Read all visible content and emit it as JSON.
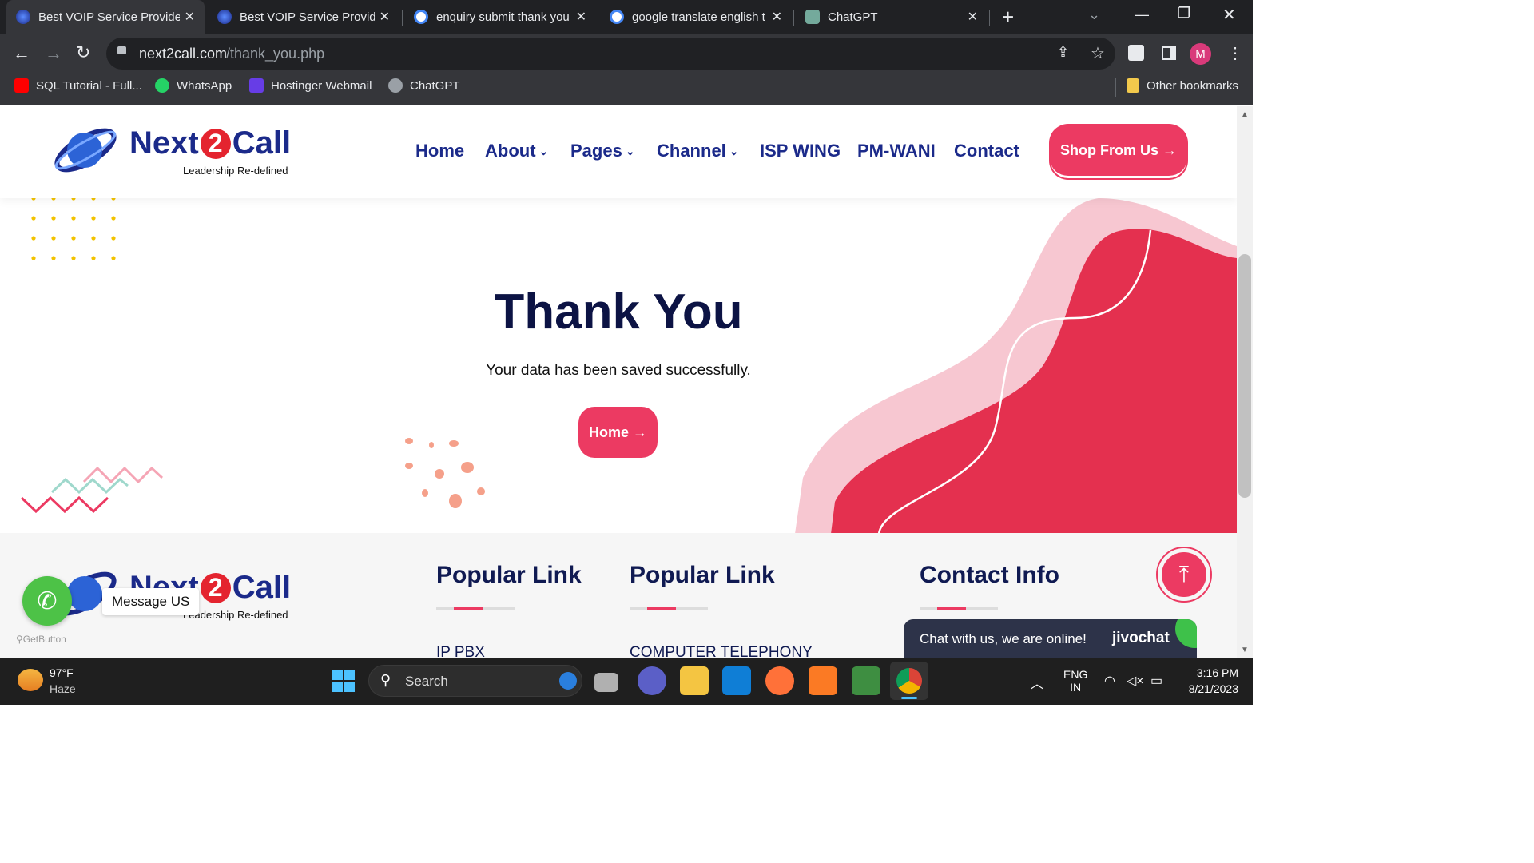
{
  "browser": {
    "tabs": [
      {
        "title": "Best VOIP Service Provider",
        "active": true
      },
      {
        "title": "Best VOIP Service Provider",
        "active": false
      },
      {
        "title": "enquiry submit thank you",
        "active": false
      },
      {
        "title": "google translate english t",
        "active": false
      },
      {
        "title": "ChatGPT",
        "active": false
      }
    ],
    "url_domain": "next2call.com",
    "url_path": "/thank_you.php",
    "profile_initial": "M",
    "bookmarks": [
      {
        "label": "SQL Tutorial - Full...",
        "color": "#ff0000"
      },
      {
        "label": "WhatsApp",
        "color": "#25d366"
      },
      {
        "label": "Hostinger Webmail",
        "color": "#673de6"
      },
      {
        "label": "ChatGPT",
        "color": "#9aa0a6"
      }
    ],
    "other_bookmarks": "Other bookmarks"
  },
  "site": {
    "logo_next": "Next",
    "logo_two": "2",
    "logo_call": "Call",
    "tagline": "Leadership Re-defined",
    "nav": [
      "Home",
      "About",
      "Pages",
      "Channel",
      "ISP WING",
      "PM-WANI",
      "Contact"
    ],
    "nav_dropdown": [
      false,
      true,
      true,
      true,
      false,
      false,
      false
    ],
    "shop_button": "Shop From Us →",
    "heading": "Thank You",
    "message": "Your data has been saved successfully.",
    "home_button": "Home →",
    "colors": {
      "primary": "#ec3a62",
      "navy": "#1b2a8a",
      "pink_light": "#f7c7d1"
    }
  },
  "footer": {
    "columns": [
      {
        "title": "Popular Link",
        "first_link": "IP PBX"
      },
      {
        "title": "Popular Link",
        "first_link": "COMPUTER TELEPHONY"
      },
      {
        "title": "Contact Info",
        "first_link": ""
      }
    ],
    "whatsapp_label": "Message US",
    "getbutton_label": "GetButton",
    "chat_text": "Chat with us, we are online!",
    "chat_brand": "jivochat",
    "scroll_top_icon": "arrow-up-icon"
  },
  "taskbar": {
    "weather_temp": "97°F",
    "weather_desc": "Haze",
    "search_placeholder": "Search",
    "lang_top": "ENG",
    "lang_bottom": "IN",
    "time": "3:16 PM",
    "date": "8/21/2023"
  }
}
